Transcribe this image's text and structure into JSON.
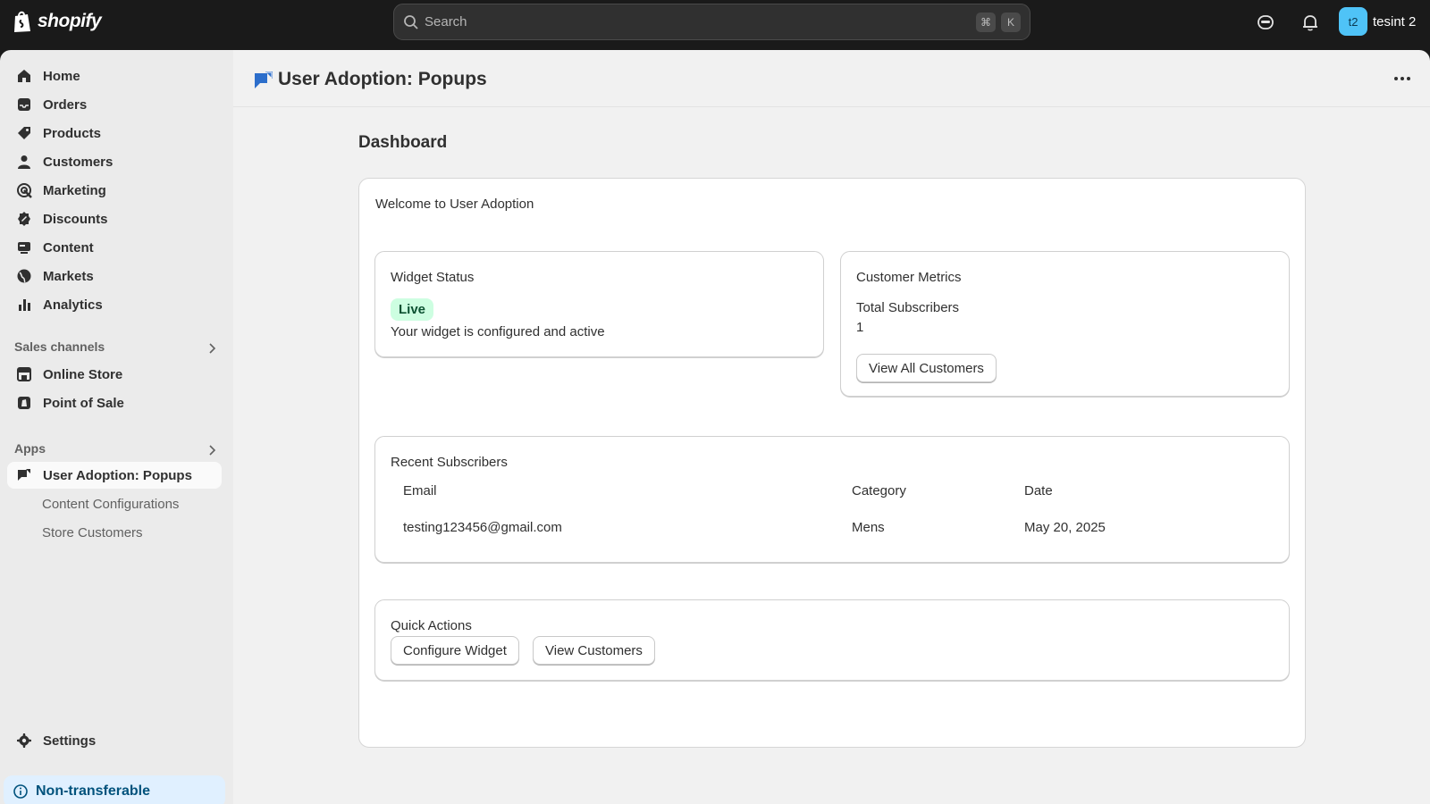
{
  "topbar": {
    "brand": "shopify",
    "search_placeholder": "Search",
    "kbd_cmd": "⌘",
    "kbd_k": "K",
    "avatar_initials": "t2",
    "store_name": "tesint 2"
  },
  "sidebar": {
    "items": [
      {
        "label": "Home",
        "icon": "home-icon"
      },
      {
        "label": "Orders",
        "icon": "inbox-icon"
      },
      {
        "label": "Products",
        "icon": "tag-icon"
      },
      {
        "label": "Customers",
        "icon": "person-icon"
      },
      {
        "label": "Marketing",
        "icon": "target-icon"
      },
      {
        "label": "Discounts",
        "icon": "discount-icon"
      },
      {
        "label": "Content",
        "icon": "content-icon"
      },
      {
        "label": "Markets",
        "icon": "globe-icon"
      },
      {
        "label": "Analytics",
        "icon": "bar-chart-icon"
      }
    ],
    "sales_channels_title": "Sales channels",
    "sales_channels": [
      {
        "label": "Online Store",
        "icon": "store-icon"
      },
      {
        "label": "Point of Sale",
        "icon": "pos-icon"
      }
    ],
    "apps_title": "Apps",
    "active_app": "User Adoption: Popups",
    "app_subitems": [
      "Content Configurations",
      "Store Customers"
    ],
    "settings": "Settings",
    "non_transferable": "Non-transferable"
  },
  "page": {
    "title": "User Adoption: Popups",
    "dashboard_title": "Dashboard",
    "welcome": "Welcome to User Adoption",
    "widget_status": {
      "title": "Widget Status",
      "badge": "Live",
      "description": "Your widget is configured and active"
    },
    "customer_metrics": {
      "title": "Customer Metrics",
      "total_label": "Total Subscribers",
      "total_value": "1",
      "button": "View All Customers"
    },
    "recent_subscribers": {
      "title": "Recent Subscribers",
      "columns": [
        "Email",
        "Category",
        "Date"
      ],
      "rows": [
        {
          "email": "testing123456@gmail.com",
          "category": "Mens",
          "date": "May 20, 2025"
        }
      ]
    },
    "quick_actions": {
      "title": "Quick Actions",
      "configure": "Configure Widget",
      "view": "View Customers"
    }
  },
  "colors": {
    "topbar": "#1a1a1a",
    "sidebar": "#ebebeb",
    "main": "#f1f1f1",
    "badge_bg": "#cdfee1",
    "badge_text": "#0c5132",
    "avatar": "#4fc3f7",
    "info_bg": "#e0f0ff"
  }
}
